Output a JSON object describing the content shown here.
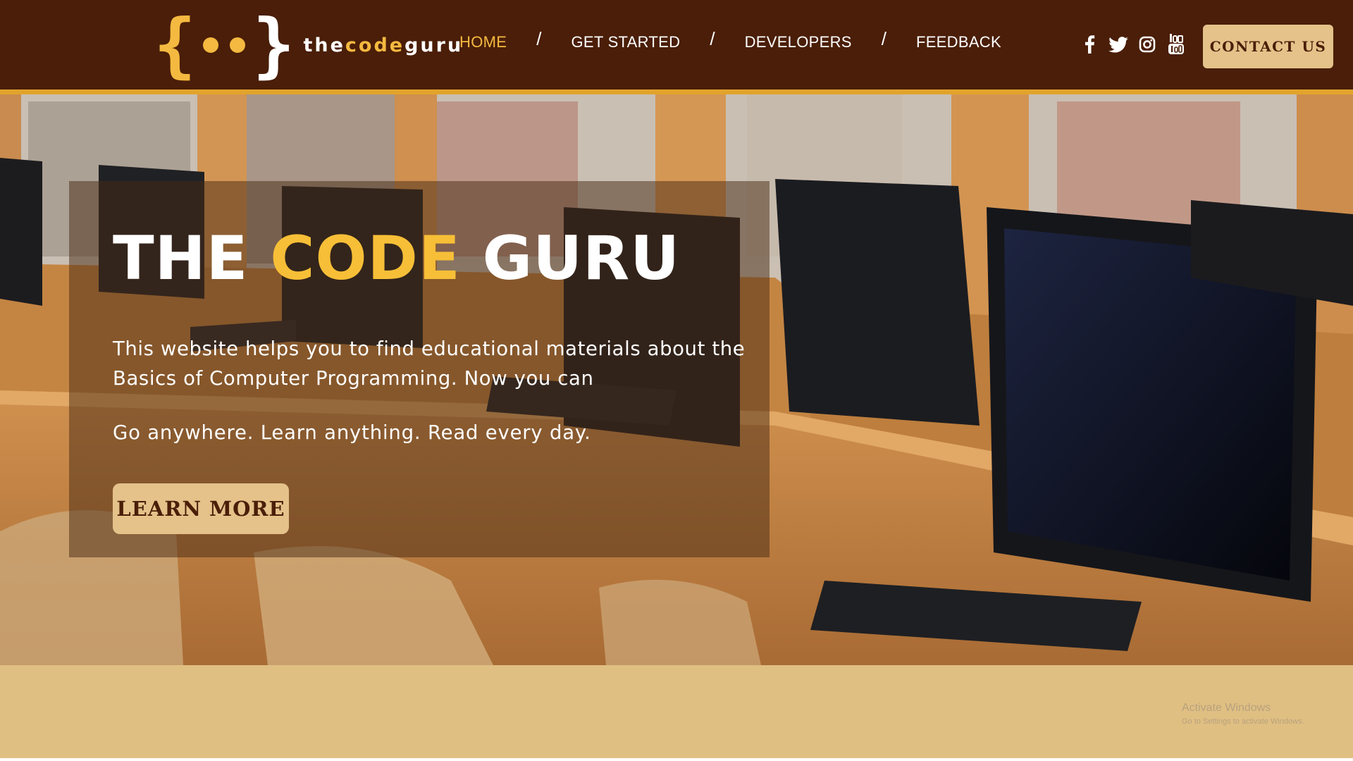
{
  "header": {
    "logo": {
      "brace_open": "{",
      "brace_close": "}",
      "text_start": "the",
      "text_mid": "code",
      "text_end": "guru"
    },
    "nav": [
      {
        "label": "HOME",
        "active": true
      },
      {
        "label": "GET STARTED",
        "active": false
      },
      {
        "label": "DEVELOPERS",
        "active": false
      },
      {
        "label": "FEEDBACK",
        "active": false
      }
    ],
    "separator": "/",
    "socials": [
      "facebook-icon",
      "twitter-icon",
      "instagram-icon",
      "youtube-icon"
    ],
    "contact_label": "CONTACT US"
  },
  "hero": {
    "title_part1": "THE ",
    "title_accent": "CODE",
    "title_part2": " GURU",
    "description": "This website helps you to find educational materials about the Basics of Computer Programming. Now you can",
    "tagline": "Go anywhere. Learn anything. Read every day.",
    "button_label": "LEARN MORE"
  },
  "watermark": {
    "title": "Activate Windows",
    "subtitle": "Go to Settings to activate Windows."
  },
  "colors": {
    "header_bg": "#4a1e08",
    "accent": "#f4b940",
    "button_bg": "#e4c28a",
    "footer_bg": "#e0bf82"
  }
}
